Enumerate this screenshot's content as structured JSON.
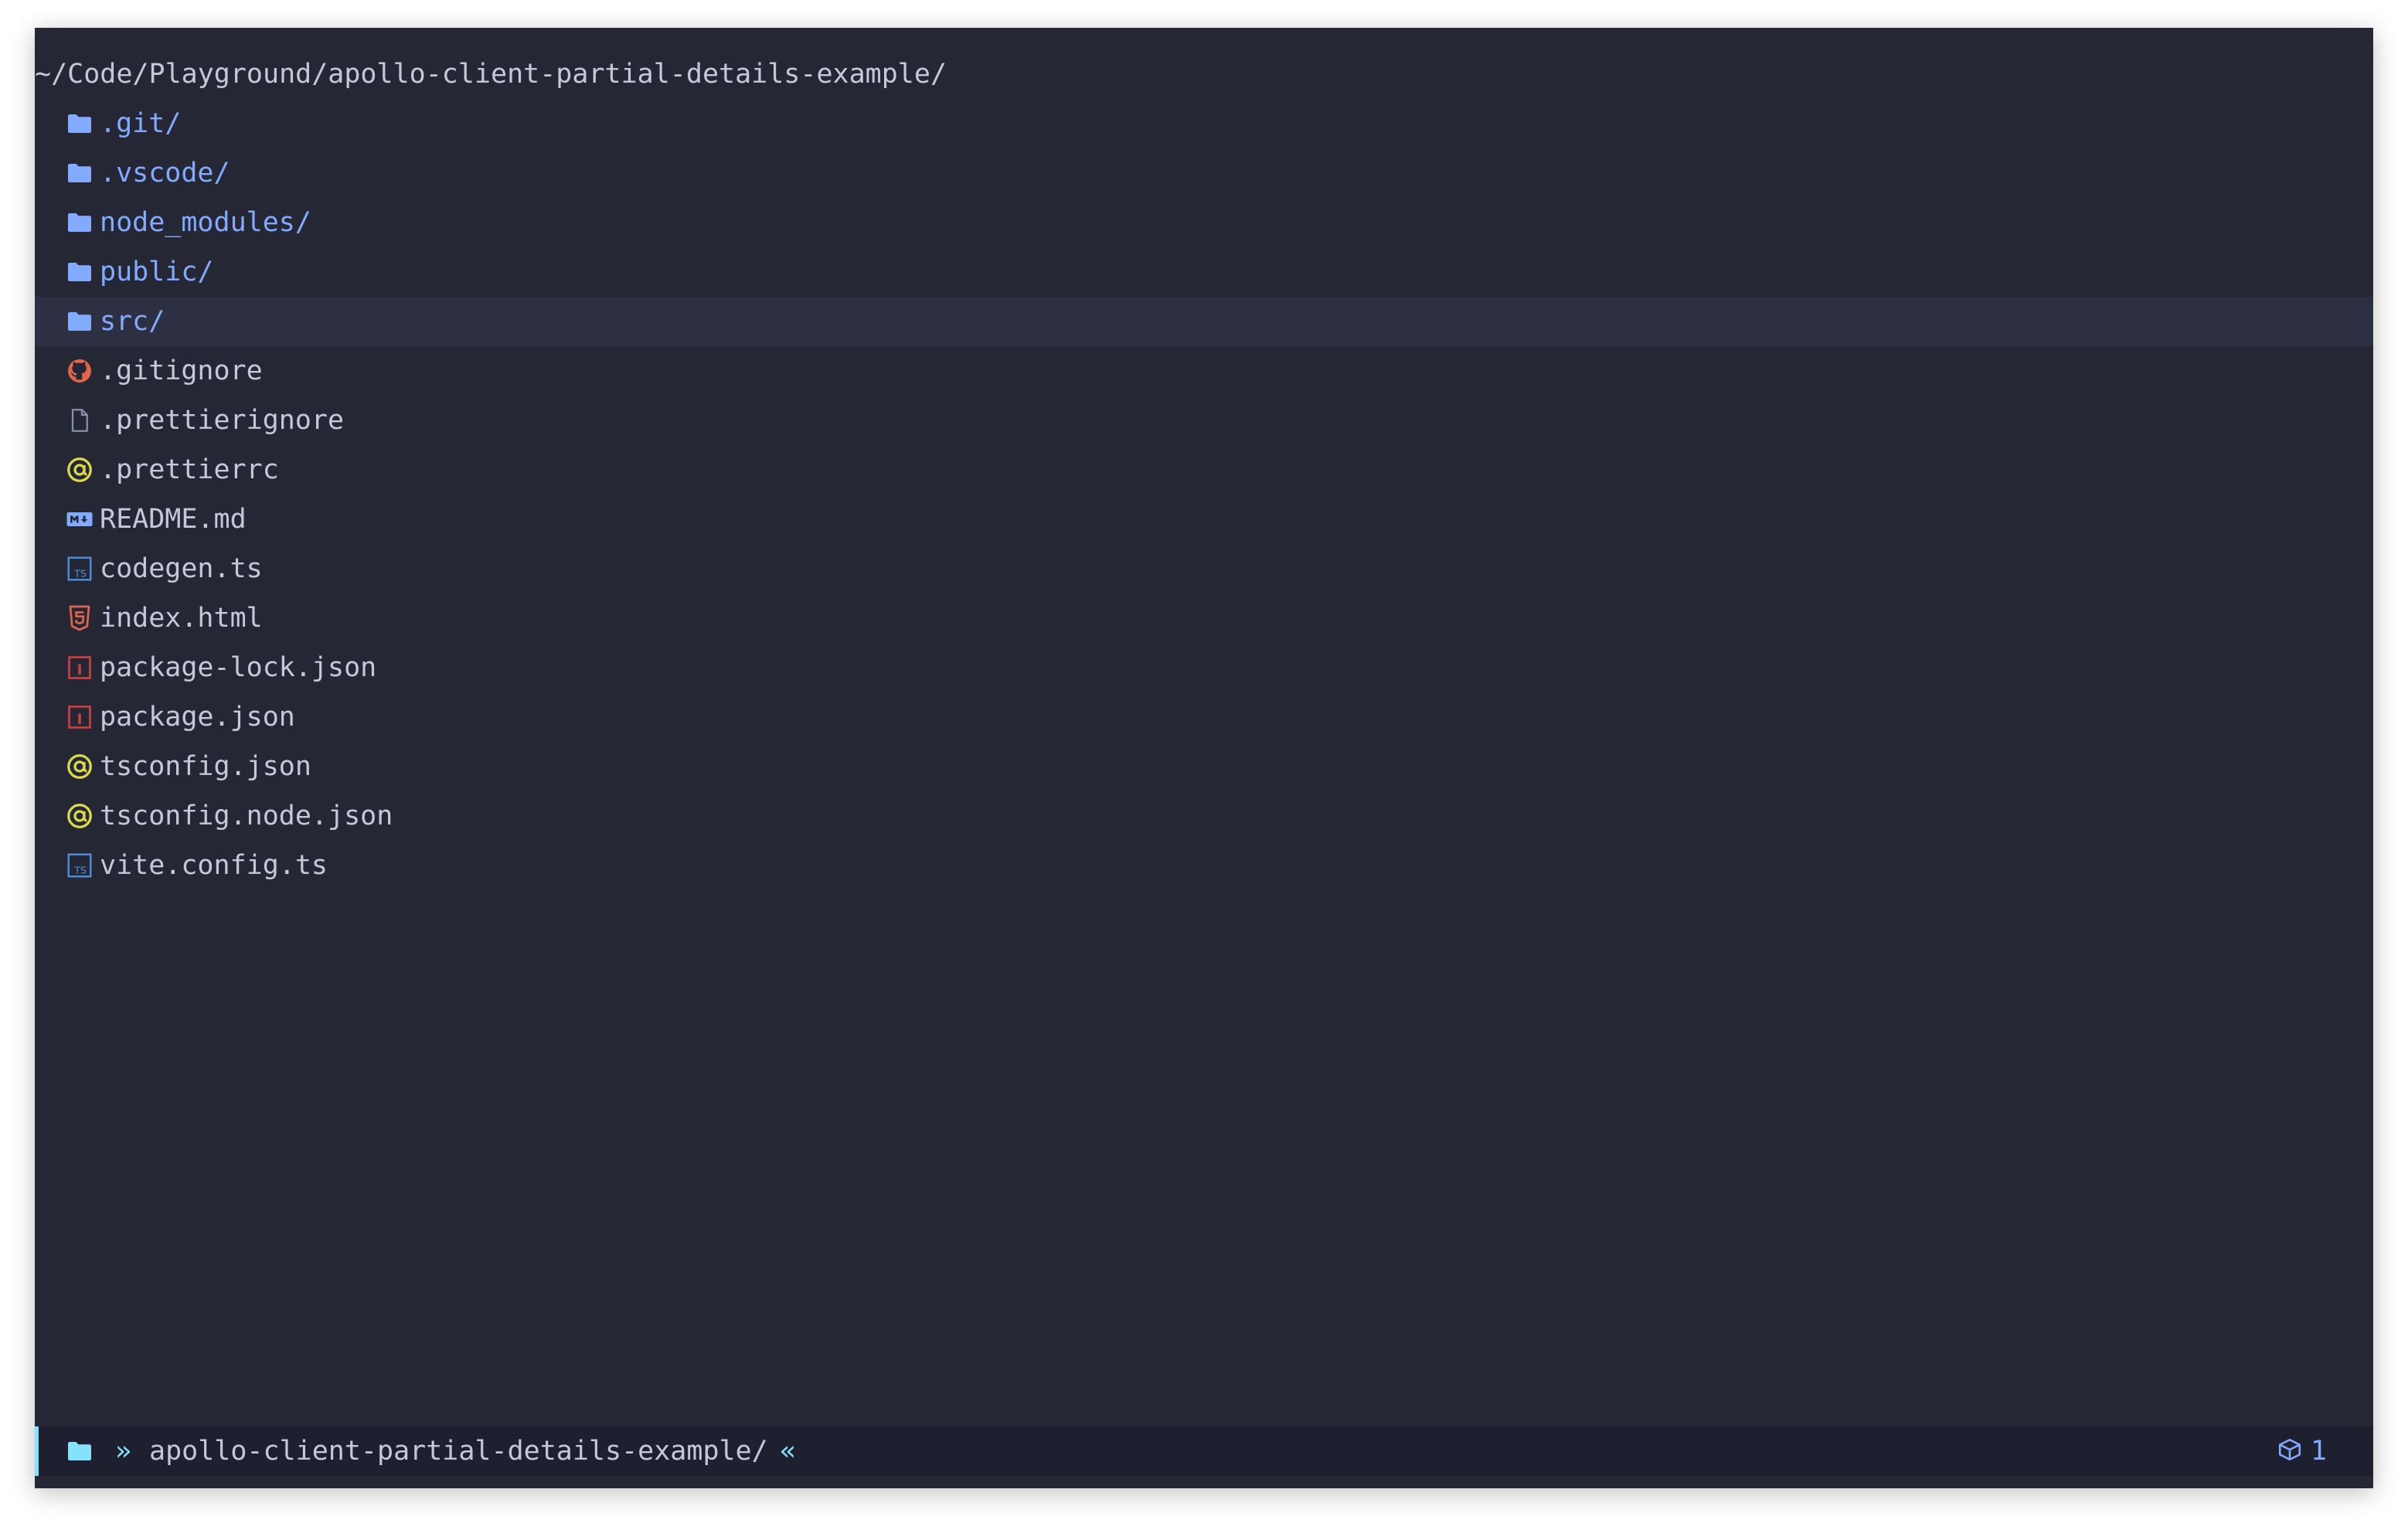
{
  "header": {
    "path": "~/Code/Playground/apollo-client-partial-details-example/"
  },
  "entries": [
    {
      "name": ".git/",
      "type": "dir",
      "icon": "folder-icon"
    },
    {
      "name": ".vscode/",
      "type": "dir",
      "icon": "folder-icon"
    },
    {
      "name": "node_modules/",
      "type": "dir",
      "icon": "folder-icon"
    },
    {
      "name": "public/",
      "type": "dir",
      "icon": "folder-icon"
    },
    {
      "name": "src/",
      "type": "dir",
      "icon": "folder-icon",
      "selected": true
    },
    {
      "name": ".gitignore",
      "type": "file",
      "icon": "github-icon"
    },
    {
      "name": ".prettierignore",
      "type": "file",
      "icon": "file-icon"
    },
    {
      "name": ".prettierrc",
      "type": "file",
      "icon": "json-icon"
    },
    {
      "name": "README.md",
      "type": "file",
      "icon": "markdown-icon"
    },
    {
      "name": "codegen.ts",
      "type": "file",
      "icon": "typescript-icon"
    },
    {
      "name": "index.html",
      "type": "file",
      "icon": "html5-icon"
    },
    {
      "name": "package-lock.json",
      "type": "file",
      "icon": "npm-icon"
    },
    {
      "name": "package.json",
      "type": "file",
      "icon": "npm-icon"
    },
    {
      "name": "tsconfig.json",
      "type": "file",
      "icon": "json-icon"
    },
    {
      "name": "tsconfig.node.json",
      "type": "file",
      "icon": "json-icon"
    },
    {
      "name": "vite.config.ts",
      "type": "file",
      "icon": "typescript-icon"
    }
  ],
  "statusbar": {
    "left_sep": "»",
    "cwd": "apollo-client-partial-details-example/",
    "right_sep": "«",
    "count": "1",
    "count_icon": "package-icon"
  },
  "colors": {
    "background": "#252735",
    "selected_row": "#2d3042",
    "statusbar": "#1e2030",
    "directory": "#82aaff",
    "file_text": "#c3c8da",
    "accent": "#86e1fc",
    "github": "#e0664b",
    "json": "#d9d94a",
    "typescript": "#4f8fd8",
    "html": "#e0664b",
    "npm": "#c94040"
  }
}
